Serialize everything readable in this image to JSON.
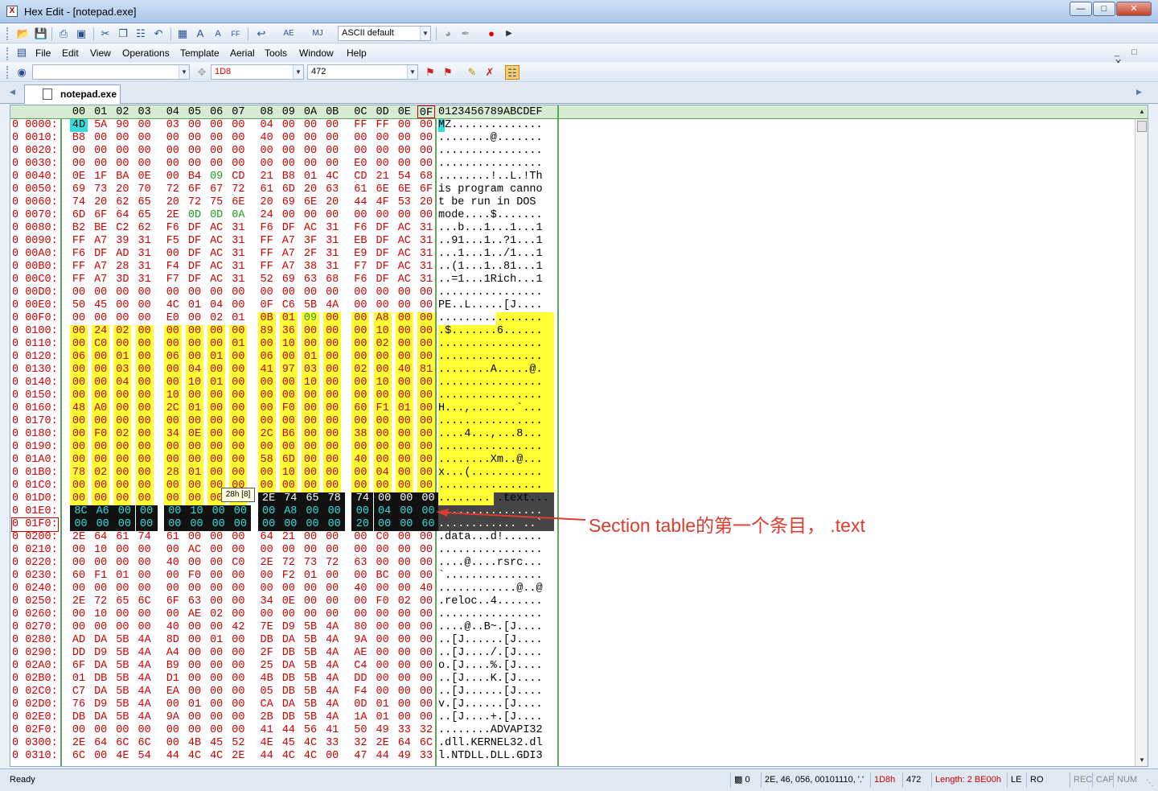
{
  "window": {
    "title": "Hex Edit - [notepad.exe]",
    "app_icon_label": "X",
    "minimize": "—",
    "maximize": "□",
    "close": "✕"
  },
  "toolbar1": {
    "charset_combo": "ASCII default",
    "icons": [
      "open-icon",
      "save-icon",
      "print-icon",
      "print-preview-icon",
      "cut-icon",
      "copy-icon",
      "paste-icon",
      "undo-icon",
      "calculator-icon",
      "font-larger-icon",
      "font-smaller-icon",
      "char-table-icon",
      "wrap-icon",
      "case-icon",
      "mark-icon",
      "search-icon",
      "record-icon",
      "play-icon"
    ]
  },
  "menu": {
    "items": [
      "File",
      "Edit",
      "View",
      "Operations",
      "Template",
      "Aerial",
      "Tools",
      "Window",
      "Help"
    ],
    "mdi_controls": "_ □ ✕"
  },
  "toolbar2": {
    "find_value": "",
    "address_value": "1D8",
    "decimal_value": "472"
  },
  "tab": {
    "label": "notepad.exe"
  },
  "header": {
    "cols": [
      "00",
      "01",
      "02",
      "03",
      "04",
      "05",
      "06",
      "07",
      "08",
      "09",
      "0A",
      "0B",
      "0C",
      "0D",
      "0E",
      "0F"
    ],
    "ascii_header": "0123456789ABCDEF"
  },
  "tooltip": "28h [8]",
  "annotation": "Section table的第一个条目， .text",
  "colors": {
    "hex_red": "#cc0000",
    "highlight_yellow": "#ffff33",
    "cursor_cyan": "#33dddd",
    "selected_black": "#111111",
    "selected_text": "#33dddd",
    "green_byte": "#1b9e1b",
    "annotation_red": "#e03a2e"
  },
  "status": {
    "ready": "Ready",
    "selection_icon_count": "0",
    "char_info": "2E, 46, 056, 00101110, '.'",
    "hex_pos": "1D8h",
    "dec_pos": "472",
    "length": "Length: 2 BE00h",
    "endian": "LE",
    "ro": "RO",
    "rec": "REC",
    "cap": "CAP",
    "num": "NUM"
  },
  "rows": [
    {
      "addr": "0 0000:",
      "bytes": [
        "4D",
        "5A",
        "90",
        "00",
        "03",
        "00",
        "00",
        "00",
        "04",
        "00",
        "00",
        "00",
        "FF",
        "FF",
        "00",
        "00"
      ],
      "ascii": "MZ.............."
    },
    {
      "addr": "0 0010:",
      "bytes": [
        "B8",
        "00",
        "00",
        "00",
        "00",
        "00",
        "00",
        "00",
        "40",
        "00",
        "00",
        "00",
        "00",
        "00",
        "00",
        "00"
      ],
      "ascii": "........@......."
    },
    {
      "addr": "0 0020:",
      "bytes": [
        "00",
        "00",
        "00",
        "00",
        "00",
        "00",
        "00",
        "00",
        "00",
        "00",
        "00",
        "00",
        "00",
        "00",
        "00",
        "00"
      ],
      "ascii": "................"
    },
    {
      "addr": "0 0030:",
      "bytes": [
        "00",
        "00",
        "00",
        "00",
        "00",
        "00",
        "00",
        "00",
        "00",
        "00",
        "00",
        "00",
        "E0",
        "00",
        "00",
        "00"
      ],
      "ascii": "................"
    },
    {
      "addr": "0 0040:",
      "bytes": [
        "0E",
        "1F",
        "BA",
        "0E",
        "00",
        "B4",
        "09",
        "CD",
        "21",
        "B8",
        "01",
        "4C",
        "CD",
        "21",
        "54",
        "68"
      ],
      "ascii": "........!..L.!Th"
    },
    {
      "addr": "0 0050:",
      "bytes": [
        "69",
        "73",
        "20",
        "70",
        "72",
        "6F",
        "67",
        "72",
        "61",
        "6D",
        "20",
        "63",
        "61",
        "6E",
        "6E",
        "6F"
      ],
      "ascii": "is program canno"
    },
    {
      "addr": "0 0060:",
      "bytes": [
        "74",
        "20",
        "62",
        "65",
        "20",
        "72",
        "75",
        "6E",
        "20",
        "69",
        "6E",
        "20",
        "44",
        "4F",
        "53",
        "20"
      ],
      "ascii": "t be run in DOS "
    },
    {
      "addr": "0 0070:",
      "bytes": [
        "6D",
        "6F",
        "64",
        "65",
        "2E",
        "0D",
        "0D",
        "0A",
        "24",
        "00",
        "00",
        "00",
        "00",
        "00",
        "00",
        "00"
      ],
      "ascii": "mode....$......."
    },
    {
      "addr": "0 0080:",
      "bytes": [
        "B2",
        "BE",
        "C2",
        "62",
        "F6",
        "DF",
        "AC",
        "31",
        "F6",
        "DF",
        "AC",
        "31",
        "F6",
        "DF",
        "AC",
        "31"
      ],
      "ascii": "...b...1...1...1"
    },
    {
      "addr": "0 0090:",
      "bytes": [
        "FF",
        "A7",
        "39",
        "31",
        "F5",
        "DF",
        "AC",
        "31",
        "FF",
        "A7",
        "3F",
        "31",
        "EB",
        "DF",
        "AC",
        "31"
      ],
      "ascii": "..91...1..?1...1"
    },
    {
      "addr": "0 00A0:",
      "bytes": [
        "F6",
        "DF",
        "AD",
        "31",
        "00",
        "DF",
        "AC",
        "31",
        "FF",
        "A7",
        "2F",
        "31",
        "E9",
        "DF",
        "AC",
        "31"
      ],
      "ascii": "...1...1../1...1"
    },
    {
      "addr": "0 00B0:",
      "bytes": [
        "FF",
        "A7",
        "28",
        "31",
        "F4",
        "DF",
        "AC",
        "31",
        "FF",
        "A7",
        "38",
        "31",
        "F7",
        "DF",
        "AC",
        "31"
      ],
      "ascii": "..(1...1..81...1"
    },
    {
      "addr": "0 00C0:",
      "bytes": [
        "FF",
        "A7",
        "3D",
        "31",
        "F7",
        "DF",
        "AC",
        "31",
        "52",
        "69",
        "63",
        "68",
        "F6",
        "DF",
        "AC",
        "31"
      ],
      "ascii": "..=1...1Rich...1"
    },
    {
      "addr": "0 00D0:",
      "bytes": [
        "00",
        "00",
        "00",
        "00",
        "00",
        "00",
        "00",
        "00",
        "00",
        "00",
        "00",
        "00",
        "00",
        "00",
        "00",
        "00"
      ],
      "ascii": "................"
    },
    {
      "addr": "0 00E0:",
      "bytes": [
        "50",
        "45",
        "00",
        "00",
        "4C",
        "01",
        "04",
        "00",
        "0F",
        "C6",
        "5B",
        "4A",
        "00",
        "00",
        "00",
        "00"
      ],
      "ascii": "PE..L.....[J...."
    },
    {
      "addr": "0 00F0:",
      "bytes": [
        "00",
        "00",
        "00",
        "00",
        "E0",
        "00",
        "02",
        "01",
        "0B",
        "01",
        "09",
        "00",
        "00",
        "A8",
        "00",
        "00"
      ],
      "ascii": "................"
    },
    {
      "addr": "0 0100:",
      "bytes": [
        "00",
        "24",
        "02",
        "00",
        "00",
        "00",
        "00",
        "00",
        "89",
        "36",
        "00",
        "00",
        "00",
        "10",
        "00",
        "00"
      ],
      "ascii": ".$.......6......"
    },
    {
      "addr": "0 0110:",
      "bytes": [
        "00",
        "C0",
        "00",
        "00",
        "00",
        "00",
        "00",
        "01",
        "00",
        "10",
        "00",
        "00",
        "00",
        "02",
        "00",
        "00"
      ],
      "ascii": "................"
    },
    {
      "addr": "0 0120:",
      "bytes": [
        "06",
        "00",
        "01",
        "00",
        "06",
        "00",
        "01",
        "00",
        "06",
        "00",
        "01",
        "00",
        "00",
        "00",
        "00",
        "00"
      ],
      "ascii": "................"
    },
    {
      "addr": "0 0130:",
      "bytes": [
        "00",
        "00",
        "03",
        "00",
        "00",
        "04",
        "00",
        "00",
        "41",
        "97",
        "03",
        "00",
        "02",
        "00",
        "40",
        "81"
      ],
      "ascii": "........A.....@."
    },
    {
      "addr": "0 0140:",
      "bytes": [
        "00",
        "00",
        "04",
        "00",
        "00",
        "10",
        "01",
        "00",
        "00",
        "00",
        "10",
        "00",
        "00",
        "10",
        "00",
        "00"
      ],
      "ascii": "................"
    },
    {
      "addr": "0 0150:",
      "bytes": [
        "00",
        "00",
        "00",
        "00",
        "10",
        "00",
        "00",
        "00",
        "00",
        "00",
        "00",
        "00",
        "00",
        "00",
        "00",
        "00"
      ],
      "ascii": "................"
    },
    {
      "addr": "0 0160:",
      "bytes": [
        "48",
        "A0",
        "00",
        "00",
        "2C",
        "01",
        "00",
        "00",
        "00",
        "F0",
        "00",
        "00",
        "60",
        "F1",
        "01",
        "00"
      ],
      "ascii": "H...,.......`..."
    },
    {
      "addr": "0 0170:",
      "bytes": [
        "00",
        "00",
        "00",
        "00",
        "00",
        "00",
        "00",
        "00",
        "00",
        "00",
        "00",
        "00",
        "00",
        "00",
        "00",
        "00"
      ],
      "ascii": "................"
    },
    {
      "addr": "0 0180:",
      "bytes": [
        "00",
        "F0",
        "02",
        "00",
        "34",
        "0E",
        "00",
        "00",
        "2C",
        "B6",
        "00",
        "00",
        "38",
        "00",
        "00",
        "00"
      ],
      "ascii": "....4...,...8..."
    },
    {
      "addr": "0 0190:",
      "bytes": [
        "00",
        "00",
        "00",
        "00",
        "00",
        "00",
        "00",
        "00",
        "00",
        "00",
        "00",
        "00",
        "00",
        "00",
        "00",
        "00"
      ],
      "ascii": "................"
    },
    {
      "addr": "0 01A0:",
      "bytes": [
        "00",
        "00",
        "00",
        "00",
        "00",
        "00",
        "00",
        "00",
        "58",
        "6D",
        "00",
        "00",
        "40",
        "00",
        "00",
        "00"
      ],
      "ascii": "........Xm..@..."
    },
    {
      "addr": "0 01B0:",
      "bytes": [
        "78",
        "02",
        "00",
        "00",
        "28",
        "01",
        "00",
        "00",
        "00",
        "10",
        "00",
        "00",
        "00",
        "04",
        "00",
        "00"
      ],
      "ascii": "x...(..........."
    },
    {
      "addr": "0 01C0:",
      "bytes": [
        "00",
        "00",
        "00",
        "00",
        "00",
        "00",
        "00",
        "00",
        "00",
        "00",
        "00",
        "00",
        "00",
        "00",
        "00",
        "00"
      ],
      "ascii": "................"
    },
    {
      "addr": "0 01D0:",
      "bytes": [
        "00",
        "00",
        "00",
        "00",
        "00",
        "00",
        "00",
        "00",
        "2E",
        "74",
        "65",
        "78",
        "74",
        "00",
        "00",
        "00"
      ],
      "ascii": "........ .text..."
    },
    {
      "addr": "0 01E0:",
      "bytes": [
        "8C",
        "A6",
        "00",
        "00",
        "00",
        "10",
        "00",
        "00",
        "00",
        "A8",
        "00",
        "00",
        "00",
        "04",
        "00",
        "00"
      ],
      "ascii": "................"
    },
    {
      "addr": "0 01F0:",
      "bytes": [
        "00",
        "00",
        "00",
        "00",
        "00",
        "00",
        "00",
        "00",
        "00",
        "00",
        "00",
        "00",
        "20",
        "00",
        "00",
        "60"
      ],
      "ascii": "............ ..`"
    },
    {
      "addr": "0 0200:",
      "bytes": [
        "2E",
        "64",
        "61",
        "74",
        "61",
        "00",
        "00",
        "00",
        "64",
        "21",
        "00",
        "00",
        "00",
        "C0",
        "00",
        "00"
      ],
      "ascii": ".data...d!......"
    },
    {
      "addr": "0 0210:",
      "bytes": [
        "00",
        "10",
        "00",
        "00",
        "00",
        "AC",
        "00",
        "00",
        "00",
        "00",
        "00",
        "00",
        "00",
        "00",
        "00",
        "00"
      ],
      "ascii": "................"
    },
    {
      "addr": "0 0220:",
      "bytes": [
        "00",
        "00",
        "00",
        "00",
        "40",
        "00",
        "00",
        "C0",
        "2E",
        "72",
        "73",
        "72",
        "63",
        "00",
        "00",
        "00"
      ],
      "ascii": "....@....rsrc..."
    },
    {
      "addr": "0 0230:",
      "bytes": [
        "60",
        "F1",
        "01",
        "00",
        "00",
        "F0",
        "00",
        "00",
        "00",
        "F2",
        "01",
        "00",
        "00",
        "BC",
        "00",
        "00"
      ],
      "ascii": "`..............."
    },
    {
      "addr": "0 0240:",
      "bytes": [
        "00",
        "00",
        "00",
        "00",
        "00",
        "00",
        "00",
        "00",
        "00",
        "00",
        "00",
        "00",
        "40",
        "00",
        "00",
        "40"
      ],
      "ascii": "............@..@"
    },
    {
      "addr": "0 0250:",
      "bytes": [
        "2E",
        "72",
        "65",
        "6C",
        "6F",
        "63",
        "00",
        "00",
        "34",
        "0E",
        "00",
        "00",
        "00",
        "F0",
        "02",
        "00"
      ],
      "ascii": ".reloc..4......."
    },
    {
      "addr": "0 0260:",
      "bytes": [
        "00",
        "10",
        "00",
        "00",
        "00",
        "AE",
        "02",
        "00",
        "00",
        "00",
        "00",
        "00",
        "00",
        "00",
        "00",
        "00"
      ],
      "ascii": "................"
    },
    {
      "addr": "0 0270:",
      "bytes": [
        "00",
        "00",
        "00",
        "00",
        "40",
        "00",
        "00",
        "42",
        "7E",
        "D9",
        "5B",
        "4A",
        "80",
        "00",
        "00",
        "00"
      ],
      "ascii": "....@..B~.[J...."
    },
    {
      "addr": "0 0280:",
      "bytes": [
        "AD",
        "DA",
        "5B",
        "4A",
        "8D",
        "00",
        "01",
        "00",
        "DB",
        "DA",
        "5B",
        "4A",
        "9A",
        "00",
        "00",
        "00"
      ],
      "ascii": "..[J......[J...."
    },
    {
      "addr": "0 0290:",
      "bytes": [
        "DD",
        "D9",
        "5B",
        "4A",
        "A4",
        "00",
        "00",
        "00",
        "2F",
        "DB",
        "5B",
        "4A",
        "AE",
        "00",
        "00",
        "00"
      ],
      "ascii": "..[J..../.[J...."
    },
    {
      "addr": "0 02A0:",
      "bytes": [
        "6F",
        "DA",
        "5B",
        "4A",
        "B9",
        "00",
        "00",
        "00",
        "25",
        "DA",
        "5B",
        "4A",
        "C4",
        "00",
        "00",
        "00"
      ],
      "ascii": "o.[J....%.[J...."
    },
    {
      "addr": "0 02B0:",
      "bytes": [
        "01",
        "DB",
        "5B",
        "4A",
        "D1",
        "00",
        "00",
        "00",
        "4B",
        "DB",
        "5B",
        "4A",
        "DD",
        "00",
        "00",
        "00"
      ],
      "ascii": "..[J....K.[J...."
    },
    {
      "addr": "0 02C0:",
      "bytes": [
        "C7",
        "DA",
        "5B",
        "4A",
        "EA",
        "00",
        "00",
        "00",
        "05",
        "DB",
        "5B",
        "4A",
        "F4",
        "00",
        "00",
        "00"
      ],
      "ascii": "..[J......[J...."
    },
    {
      "addr": "0 02D0:",
      "bytes": [
        "76",
        "D9",
        "5B",
        "4A",
        "00",
        "01",
        "00",
        "00",
        "CA",
        "DA",
        "5B",
        "4A",
        "0D",
        "01",
        "00",
        "00"
      ],
      "ascii": "v.[J......[J...."
    },
    {
      "addr": "0 02E0:",
      "bytes": [
        "DB",
        "DA",
        "5B",
        "4A",
        "9A",
        "00",
        "00",
        "00",
        "2B",
        "DB",
        "5B",
        "4A",
        "1A",
        "01",
        "00",
        "00"
      ],
      "ascii": "..[J....+.[J...."
    },
    {
      "addr": "0 02F0:",
      "bytes": [
        "00",
        "00",
        "00",
        "00",
        "00",
        "00",
        "00",
        "00",
        "41",
        "44",
        "56",
        "41",
        "50",
        "49",
        "33",
        "32"
      ],
      "ascii": "........ADVAPI32"
    },
    {
      "addr": "0 0300:",
      "bytes": [
        "2E",
        "64",
        "6C",
        "6C",
        "00",
        "4B",
        "45",
        "52",
        "4E",
        "45",
        "4C",
        "33",
        "32",
        "2E",
        "64",
        "6C"
      ],
      "ascii": ".dll.KERNEL32.dl"
    },
    {
      "addr": "0 0310:",
      "bytes": [
        "6C",
        "00",
        "4E",
        "54",
        "44",
        "4C",
        "4C",
        "2E",
        "44",
        "4C",
        "4C",
        "00",
        "47",
        "44",
        "49",
        "33"
      ],
      "ascii": "l.NTDLL.DLL.GDI3"
    }
  ]
}
